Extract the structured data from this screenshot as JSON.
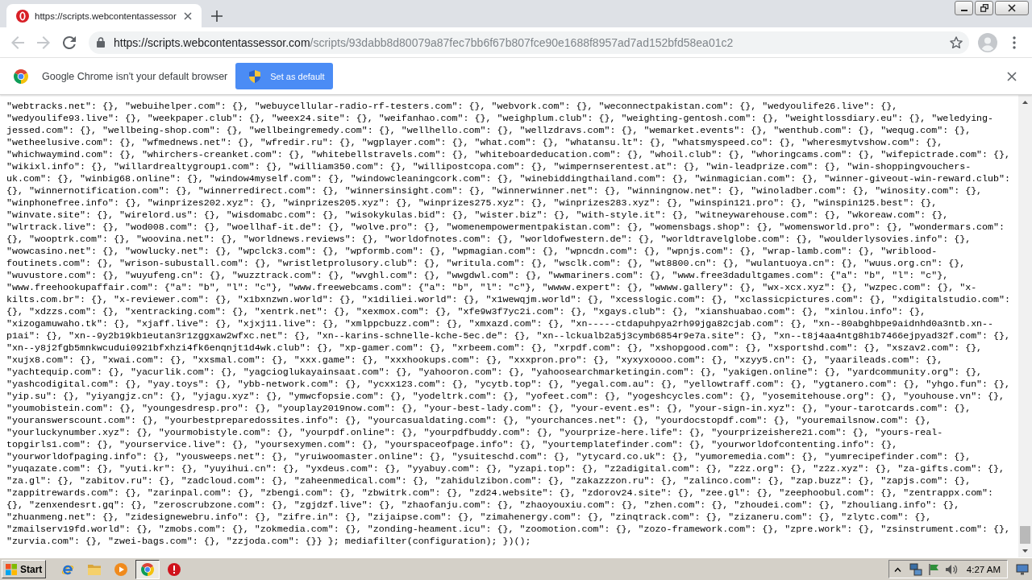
{
  "tabs": [
    {
      "title": "https://scripts.webcontentassessor",
      "selected": true
    }
  ],
  "toolbar": {
    "nav_buttons": [
      {
        "kind": "back",
        "disabled": true
      },
      {
        "kind": "forward",
        "disabled": true
      },
      {
        "kind": "reload",
        "disabled": false
      }
    ],
    "url_host": "https://scripts.webcontentassessor.com",
    "url_path": "/scripts/93dabb8d80079a87fec7bb6f67b807fce90e1688f8957ad7ad152bfd58ea01c2"
  },
  "infobar": {
    "message": "Google Chrome isn't your default browser",
    "button": "Set as default"
  },
  "document": {
    "lines": [
      "\"webtracks.net\": {}, \"webuihelper.com\": {}, \"webuycellular-radio-rf-testers.com\": {}, \"webvork.com\": {}, \"weconnectpakistan.com\": {}, \"wedyoulife26.live\": {},",
      "\"wedyoulife93.live\": {}, \"weekpaper.club\": {}, \"weex24.site\": {}, \"weifanhao.com\": {}, \"weighplum.club\": {}, \"weighting-gentosh.com\": {}, \"weightlossdiary.eu\": {}, \"weledying-",
      "jessed.com\": {}, \"wellbeing-shop.com\": {}, \"wellbeingremedy.com\": {}, \"wellhello.com\": {}, \"wellzdravs.com\": {}, \"wemarket.events\": {}, \"wenthub.com\": {}, \"wequg.com\": {},",
      "\"wetheelusive.com\": {}, \"wfmednews.net\": {}, \"wfredir.ru\": {}, \"wgplayer.com\": {}, \"what.com\": {}, \"whatansu.lt\": {}, \"whatsmyspeed.co\": {}, \"wheresmytvshow.com\": {},",
      "\"whichwaymind.com\": {}, \"whirchers-creanket.com\": {}, \"whitebellstravels.com\": {}, \"whiteboardeducation.com\": {}, \"whoil.club\": {}, \"whoringcams.com\": {}, \"wifepictrade.com\": {},",
      "\"wikixl.info\": {}, \"willardrealtygroup1.com\": {}, \"william350.com\": {}, \"willipostcopa.com\": {}, \"wimpernserentest.at\": {}, \"win-leadprize.com\": {}, \"win-shoppingvouchers-",
      "uk.com\": {}, \"winbig68.online\": {}, \"window4myself.com\": {}, \"windowcleaningcork.com\": {}, \"winebiddingthailand.com\": {}, \"winmagician.com\": {}, \"winner-giveout-win-reward.club\":",
      "{}, \"winnernotification.com\": {}, \"winnerredirect.com\": {}, \"winnersinsight.com\": {}, \"winnerwinner.net\": {}, \"winningnow.net\": {}, \"winoladber.com\": {}, \"winosity.com\": {},",
      "\"winphonefree.info\": {}, \"winprizes202.xyz\": {}, \"winprizes205.xyz\": {}, \"winprizes275.xyz\": {}, \"winprizes283.xyz\": {}, \"winspin121.pro\": {}, \"winspin125.best\": {},",
      "\"winvate.site\": {}, \"wirelord.us\": {}, \"wisdomabc.com\": {}, \"wisokykulas.bid\": {}, \"wister.biz\": {}, \"with-style.it\": {}, \"witneywarehouse.com\": {}, \"wkoreaw.com\": {},",
      "\"wlrtrack.live\": {}, \"wod008.com\": {}, \"woellhaf-it.de\": {}, \"wolve.pro\": {}, \"womenempowermentpakistan.com\": {}, \"womensbags.shop\": {}, \"womensworld.pro\": {}, \"wondermars.com\":",
      "{}, \"wooptrk.com\": {}, \"woovina.net\": {}, \"worldnews.reviews\": {}, \"worldofnotes.com\": {}, \"worldofwestern.de\": {}, \"worldtravelglobe.com\": {}, \"woulderlysovies.info\": {},",
      "\"wowcasino.net\": {}, \"wowlucky.net\": {}, \"wpclck3.com\": {}, \"wpformb.com\": {}, \"wpmagian.com\": {}, \"wpncdn.com\": {}, \"wpnjs.com\": {}, \"wrap-lamb.com\": {}, \"wriblood-",
      "foutinets.com\": {}, \"wrison-subustall.com\": {}, \"wristletprolusory.club\": {}, \"writula.com\": {}, \"wsclk.com\": {}, \"wt8800.cn\": {}, \"wulantuoya.cn\": {}, \"wuus.org.cn\": {},",
      "\"wuvustore.com\": {}, \"wuyufeng.cn\": {}, \"wuzztrack.com\": {}, \"wvghl.com\": {}, \"wwgdwl.com\": {}, \"wwmariners.com\": {}, \"www.free3dadultgames.com\": {\"a\": \"b\", \"l\": \"c\"},",
      "\"www.freehookupaffair.com\": {\"a\": \"b\", \"l\": \"c\"}, \"www.freewebcams.com\": {\"a\": \"b\", \"l\": \"c\"}, \"wwww.expert\": {}, \"wwww.gallery\": {}, \"wx-xcx.xyz\": {}, \"wzpec.com\": {}, \"x-",
      "kilts.com.br\": {}, \"x-reviewer.com\": {}, \"x1bxnzwn.world\": {}, \"x1diliei.world\": {}, \"x1wewqjm.world\": {}, \"xcesslogic.com\": {}, \"xclassicpictures.com\": {}, \"xdigitalstudio.com\":",
      "{}, \"xdzzs.com\": {}, \"xentracking.com\": {}, \"xentrk.net\": {}, \"xexmox.com\": {}, \"xfe9w3f7yc2i.com\": {}, \"xgays.club\": {}, \"xianshuabao.com\": {}, \"xinlou.info\": {},",
      "\"xizogamuwaho.tk\": {}, \"xjaff.live\": {}, \"xjxj11.live\": {}, \"xmlppcbuzz.com\": {}, \"xmxazd.com\": {}, \"xn-----ctdapuhpya2rh99jga82cjab.com\": {}, \"xn--80abghbpe9aidnhd0a3ntb.xn--",
      "p1ai\": {}, \"xn--9y2b19kb1eutan3r1zggxaw2wfxc.net\": {}, \"xn--karins-schnelle-kche-5ec.de\": {}, \"xn--lckualb2a5j3cymb6854r9e7a.site\": {}, \"xn--t8j4aa4ntg8h1b7466ejpyad32f.com\": {},",
      "\"xn--y8j2fgb5mnkwcudui0921bfxhzi4fk6enqnjt1d4wk.club\": {}, \"xp-gamer.com\": {}, \"xrbeem.com\": {}, \"xrpdf.com\": {}, \"xshopgood.com\": {}, \"xsportshd.com\": {}, \"xszav2.com\": {},",
      "\"xujx8.com\": {}, \"xwai.com\": {}, \"xxsmal.com\": {}, \"xxx.game\": {}, \"xxxhookups.com\": {}, \"xxxpron.pro\": {}, \"xyxyxoooo.com\": {}, \"xzyy5.cn\": {}, \"yaarileads.com\": {},",
      "\"yachtequip.com\": {}, \"yacurlik.com\": {}, \"yagcioglukayainsaat.com\": {}, \"yahooron.com\": {}, \"yahoosearchmarketingin.com\": {}, \"yakigen.online\": {}, \"yardcommunity.org\": {},",
      "\"yashcodigital.com\": {}, \"yay.toys\": {}, \"ybb-network.com\": {}, \"ycxx123.com\": {}, \"ycytb.top\": {}, \"yegal.com.au\": {}, \"yellowtraff.com\": {}, \"ygtanero.com\": {}, \"yhgo.fun\": {},",
      "\"yip.su\": {}, \"yiyangjz.cn\": {}, \"yjagu.xyz\": {}, \"ymwcfopsie.com\": {}, \"yodeltrk.com\": {}, \"yofeet.com\": {}, \"yogeshcycles.com\": {}, \"yosemitehouse.org\": {}, \"youhouse.vn\": {},",
      "\"youmobistein.com\": {}, \"youngesdresp.pro\": {}, \"youplay2019now.com\": {}, \"your-best-lady.com\": {}, \"your-event.es\": {}, \"your-sign-in.xyz\": {}, \"your-tarotcards.com\": {},",
      "\"youranswerscount.com\": {}, \"yourbestpreparedossites.info\": {}, \"yourcasualdating.com\": {}, \"yourchances.net\": {}, \"yourdocstopdf.com\": {}, \"youremailsnow.com\": {},",
      "\"yourluckynumber.xyz\": {}, \"yourmobistyle.com\": {}, \"yourpdf.online\": {}, \"yourpdfbuddy.com\": {}, \"yourprize-here.life\": {}, \"yourprizeishere21.com\": {}, \"yours-real-",
      "topgirls1.com\": {}, \"yourservice.live\": {}, \"yoursexymen.com\": {}, \"yourspaceofpage.info\": {}, \"yourtemplatefinder.com\": {}, \"yourworldofcontenting.info\": {},",
      "\"yourworldofpaging.info\": {}, \"yousweeps.net\": {}, \"yruiwoomaster.online\": {}, \"ysuiteschd.com\": {}, \"ytycard.co.uk\": {}, \"yumoremedia.com\": {}, \"yumrecipefinder.com\": {},",
      "\"yuqazate.com\": {}, \"yuti.kr\": {}, \"yuyihui.cn\": {}, \"yxdeus.com\": {}, \"yyabuy.com\": {}, \"yzapi.top\": {}, \"z2adigital.com\": {}, \"z2z.org\": {}, \"z2z.xyz\": {}, \"za-gifts.com\": {},",
      "\"za.gl\": {}, \"zabitov.ru\": {}, \"zadcloud.com\": {}, \"zaheenmedical.com\": {}, \"zahidulzibon.com\": {}, \"zakazzzon.ru\": {}, \"zalinco.com\": {}, \"zap.buzz\": {}, \"zapjs.com\": {},",
      "\"zappitrewards.com\": {}, \"zarinpal.com\": {}, \"zbengi.com\": {}, \"zbwitrk.com\": {}, \"zd24.website\": {}, \"zdorov24.site\": {}, \"zee.gl\": {}, \"zeephoobul.com\": {}, \"zentrappx.com\":",
      "{}, \"zenxendesrt.gq\": {}, \"zeroscrubzone.com\": {}, \"zgjdzf.live\": {}, \"zhaofanju.com\": {}, \"zhaoyouxiu.com\": {}, \"zhen.com\": {}, \"zhoudei.com\": {}, \"zhouliang.info\": {},",
      "\"zhuanmeng.net\": {}, \"zidesignewebru.info\": {}, \"zifre.in\": {}, \"zijaipse.com\": {}, \"zimahenergy.com\": {}, \"zinqtrack.com\": {}, \"zizaneru.com\": {}, \"zlytc.com\": {},",
      "\"zmailserv19fd.world\": {}, \"zmobs.com\": {}, \"zokmedia.com\": {}, \"zonding-heament.icu\": {}, \"zoomotion.com\": {}, \"zozo-framework.com\": {}, \"zpre.work\": {}, \"zsinstrument.com\": {},",
      "\"zurvia.com\": {}, \"zwei-bags.com\": {}, \"zzjoda.com\": {}} }; mediafilter(configuration); })();"
    ]
  },
  "taskbar": {
    "start": "Start",
    "apps": [
      {
        "kind": "ie",
        "selected": false
      },
      {
        "kind": "folder",
        "selected": false
      },
      {
        "kind": "media",
        "selected": false
      },
      {
        "kind": "chrome",
        "selected": true
      },
      {
        "kind": "alert",
        "selected": false
      }
    ],
    "clock": "4:27 AM"
  }
}
